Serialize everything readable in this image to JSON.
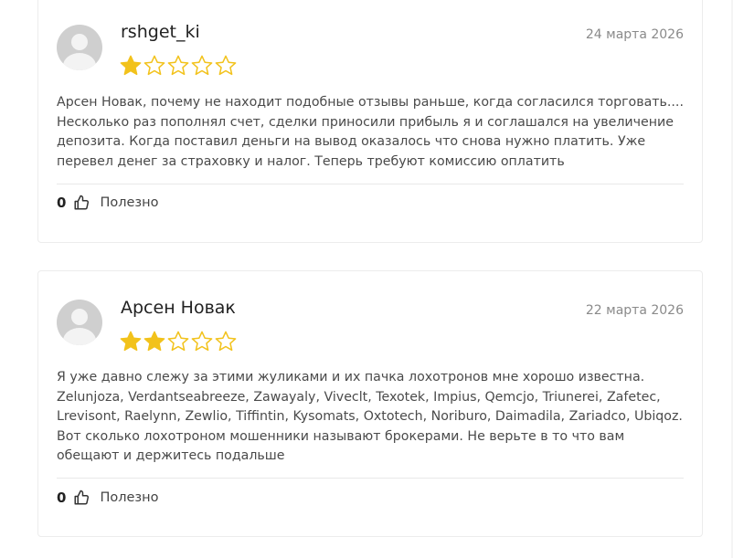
{
  "reviews": [
    {
      "author": "rshget_ki",
      "date": "24 марта 2026",
      "rating": 1,
      "max_rating": 5,
      "text": "Арсен Новак, почему не находит подобные отзывы раньше, когда согласился торговать.... Несколько раз пополнял счет, сделки приносили прибыль я и соглашался на увеличение депозита. Когда поставил деньги на вывод оказалось что снова нужно платить. Уже перевел денег за страховку и налог. Теперь требуют комиссию оплатить",
      "helpful_count": "0",
      "helpful_label": "Полезно"
    },
    {
      "author": "Арсен Новак",
      "date": "22 марта 2026",
      "rating": 2,
      "max_rating": 5,
      "text": "Я уже давно слежу за этими жуликами и их пачка лохотронов мне хорошо известна. Zelunjoza, Verdantseabreeze, Zawayaly, Viveclt, Texotek, Impius, Qemcjo, Triunerei, Zafetec, Lrevisont, Raelynn, Zewlio, Tiffintin, Kysomats, Oxtotech, Noriburo, Daimadila, Zariadco, Ubiqoz. Вот сколько лохотроном мошенники называют брокерами. Не верьте в то что вам обещают и держитесь подальше",
      "helpful_count": "0",
      "helpful_label": "Полезно"
    }
  ],
  "icons": {
    "avatar": "user-placeholder-icon",
    "star_filled": "star-filled-icon",
    "star_empty": "star-outline-icon",
    "like": "thumbs-up-icon"
  },
  "colors": {
    "star": "#f2c21b",
    "avatar": "#cfcfcf",
    "border": "#ececec",
    "date": "#8a8a8a"
  }
}
